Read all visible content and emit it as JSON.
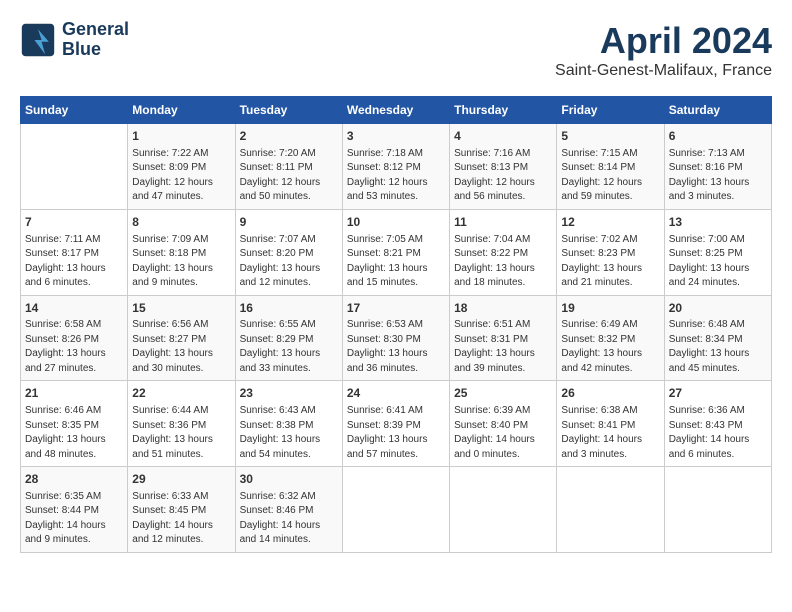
{
  "header": {
    "logo_line1": "General",
    "logo_line2": "Blue",
    "title": "April 2024",
    "subtitle": "Saint-Genest-Malifaux, France"
  },
  "days_of_week": [
    "Sunday",
    "Monday",
    "Tuesday",
    "Wednesday",
    "Thursday",
    "Friday",
    "Saturday"
  ],
  "weeks": [
    [
      {
        "day": "",
        "content": ""
      },
      {
        "day": "1",
        "content": "Sunrise: 7:22 AM\nSunset: 8:09 PM\nDaylight: 12 hours\nand 47 minutes."
      },
      {
        "day": "2",
        "content": "Sunrise: 7:20 AM\nSunset: 8:11 PM\nDaylight: 12 hours\nand 50 minutes."
      },
      {
        "day": "3",
        "content": "Sunrise: 7:18 AM\nSunset: 8:12 PM\nDaylight: 12 hours\nand 53 minutes."
      },
      {
        "day": "4",
        "content": "Sunrise: 7:16 AM\nSunset: 8:13 PM\nDaylight: 12 hours\nand 56 minutes."
      },
      {
        "day": "5",
        "content": "Sunrise: 7:15 AM\nSunset: 8:14 PM\nDaylight: 12 hours\nand 59 minutes."
      },
      {
        "day": "6",
        "content": "Sunrise: 7:13 AM\nSunset: 8:16 PM\nDaylight: 13 hours\nand 3 minutes."
      }
    ],
    [
      {
        "day": "7",
        "content": "Sunrise: 7:11 AM\nSunset: 8:17 PM\nDaylight: 13 hours\nand 6 minutes."
      },
      {
        "day": "8",
        "content": "Sunrise: 7:09 AM\nSunset: 8:18 PM\nDaylight: 13 hours\nand 9 minutes."
      },
      {
        "day": "9",
        "content": "Sunrise: 7:07 AM\nSunset: 8:20 PM\nDaylight: 13 hours\nand 12 minutes."
      },
      {
        "day": "10",
        "content": "Sunrise: 7:05 AM\nSunset: 8:21 PM\nDaylight: 13 hours\nand 15 minutes."
      },
      {
        "day": "11",
        "content": "Sunrise: 7:04 AM\nSunset: 8:22 PM\nDaylight: 13 hours\nand 18 minutes."
      },
      {
        "day": "12",
        "content": "Sunrise: 7:02 AM\nSunset: 8:23 PM\nDaylight: 13 hours\nand 21 minutes."
      },
      {
        "day": "13",
        "content": "Sunrise: 7:00 AM\nSunset: 8:25 PM\nDaylight: 13 hours\nand 24 minutes."
      }
    ],
    [
      {
        "day": "14",
        "content": "Sunrise: 6:58 AM\nSunset: 8:26 PM\nDaylight: 13 hours\nand 27 minutes."
      },
      {
        "day": "15",
        "content": "Sunrise: 6:56 AM\nSunset: 8:27 PM\nDaylight: 13 hours\nand 30 minutes."
      },
      {
        "day": "16",
        "content": "Sunrise: 6:55 AM\nSunset: 8:29 PM\nDaylight: 13 hours\nand 33 minutes."
      },
      {
        "day": "17",
        "content": "Sunrise: 6:53 AM\nSunset: 8:30 PM\nDaylight: 13 hours\nand 36 minutes."
      },
      {
        "day": "18",
        "content": "Sunrise: 6:51 AM\nSunset: 8:31 PM\nDaylight: 13 hours\nand 39 minutes."
      },
      {
        "day": "19",
        "content": "Sunrise: 6:49 AM\nSunset: 8:32 PM\nDaylight: 13 hours\nand 42 minutes."
      },
      {
        "day": "20",
        "content": "Sunrise: 6:48 AM\nSunset: 8:34 PM\nDaylight: 13 hours\nand 45 minutes."
      }
    ],
    [
      {
        "day": "21",
        "content": "Sunrise: 6:46 AM\nSunset: 8:35 PM\nDaylight: 13 hours\nand 48 minutes."
      },
      {
        "day": "22",
        "content": "Sunrise: 6:44 AM\nSunset: 8:36 PM\nDaylight: 13 hours\nand 51 minutes."
      },
      {
        "day": "23",
        "content": "Sunrise: 6:43 AM\nSunset: 8:38 PM\nDaylight: 13 hours\nand 54 minutes."
      },
      {
        "day": "24",
        "content": "Sunrise: 6:41 AM\nSunset: 8:39 PM\nDaylight: 13 hours\nand 57 minutes."
      },
      {
        "day": "25",
        "content": "Sunrise: 6:39 AM\nSunset: 8:40 PM\nDaylight: 14 hours\nand 0 minutes."
      },
      {
        "day": "26",
        "content": "Sunrise: 6:38 AM\nSunset: 8:41 PM\nDaylight: 14 hours\nand 3 minutes."
      },
      {
        "day": "27",
        "content": "Sunrise: 6:36 AM\nSunset: 8:43 PM\nDaylight: 14 hours\nand 6 minutes."
      }
    ],
    [
      {
        "day": "28",
        "content": "Sunrise: 6:35 AM\nSunset: 8:44 PM\nDaylight: 14 hours\nand 9 minutes."
      },
      {
        "day": "29",
        "content": "Sunrise: 6:33 AM\nSunset: 8:45 PM\nDaylight: 14 hours\nand 12 minutes."
      },
      {
        "day": "30",
        "content": "Sunrise: 6:32 AM\nSunset: 8:46 PM\nDaylight: 14 hours\nand 14 minutes."
      },
      {
        "day": "",
        "content": ""
      },
      {
        "day": "",
        "content": ""
      },
      {
        "day": "",
        "content": ""
      },
      {
        "day": "",
        "content": ""
      }
    ]
  ]
}
